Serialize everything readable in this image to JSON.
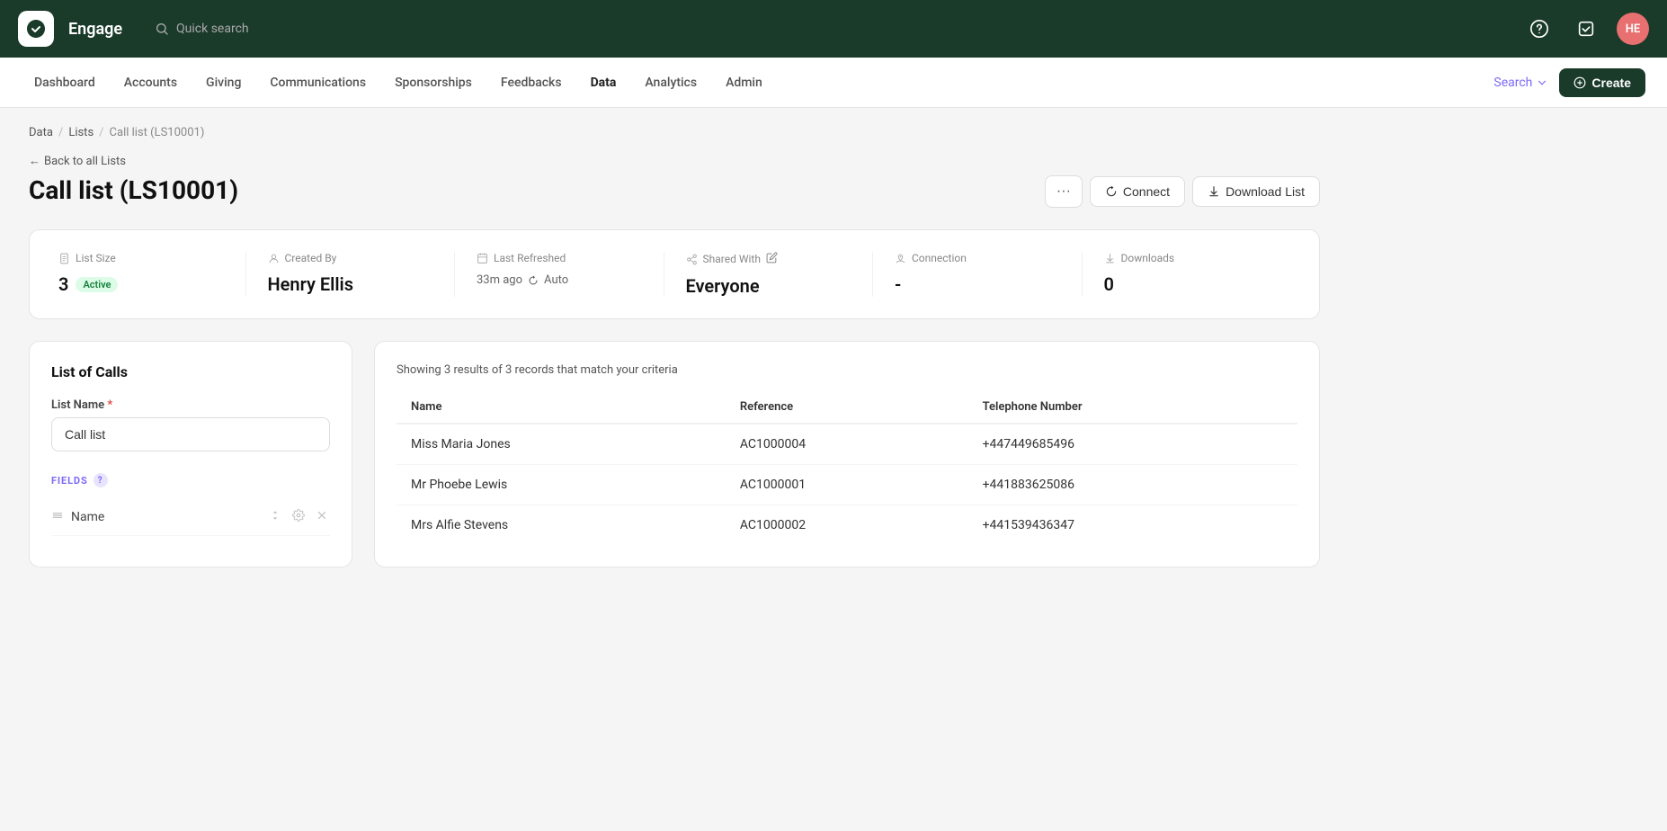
{
  "app": {
    "name": "Engage",
    "logo_alt": "Engage logo"
  },
  "topbar": {
    "quick_search": "Quick search",
    "avatar_initials": "HE",
    "help_icon": "?",
    "task_icon": "✓"
  },
  "nav": {
    "items": [
      {
        "id": "dashboard",
        "label": "Dashboard",
        "active": false
      },
      {
        "id": "accounts",
        "label": "Accounts",
        "active": false
      },
      {
        "id": "giving",
        "label": "Giving",
        "active": false
      },
      {
        "id": "communications",
        "label": "Communications",
        "active": false
      },
      {
        "id": "sponsorships",
        "label": "Sponsorships",
        "active": false
      },
      {
        "id": "feedbacks",
        "label": "Feedbacks",
        "active": false
      },
      {
        "id": "data",
        "label": "Data",
        "active": true
      },
      {
        "id": "analytics",
        "label": "Analytics",
        "active": false
      },
      {
        "id": "admin",
        "label": "Admin",
        "active": false
      }
    ],
    "search_label": "Search",
    "create_label": "Create"
  },
  "breadcrumb": {
    "items": [
      "Data",
      "Lists",
      "Call list (LS10001)"
    ]
  },
  "back_link": "Back to all Lists",
  "page": {
    "title": "Call list (LS10001)",
    "more_btn": "···",
    "connect_btn": "Connect",
    "download_btn": "Download List"
  },
  "stats": {
    "list_size_label": "List Size",
    "list_size_value": "3",
    "list_size_status": "Active",
    "created_by_label": "Created By",
    "created_by_value": "Henry Ellis",
    "last_refreshed_label": "Last Refreshed",
    "last_refreshed_value": "33m ago",
    "last_refreshed_mode": "Auto",
    "shared_with_label": "Shared With",
    "shared_with_value": "Everyone",
    "connection_label": "Connection",
    "connection_value": "-",
    "downloads_label": "Downloads",
    "downloads_value": "0"
  },
  "left_panel": {
    "title": "List of Calls",
    "list_name_label": "List Name",
    "list_name_required": true,
    "list_name_value": "Call list",
    "fields_label": "FIELDS",
    "fields_help": "?",
    "field_rows": [
      {
        "label": "Name"
      }
    ]
  },
  "right_panel": {
    "results_info": "Showing 3 results of 3 records that match your criteria",
    "columns": [
      "Name",
      "Reference",
      "Telephone Number"
    ],
    "rows": [
      {
        "name": "Miss Maria Jones",
        "reference": "AC1000004",
        "telephone": "+447449685496"
      },
      {
        "name": "Mr Phoebe Lewis",
        "reference": "AC1000001",
        "telephone": "+441883625086"
      },
      {
        "name": "Mrs Alfie Stevens",
        "reference": "AC1000002",
        "telephone": "+441539436347"
      }
    ]
  },
  "icons": {
    "search": "🔍",
    "help": "?",
    "task": "☑",
    "back_arrow": "←",
    "connect": "⟳",
    "download": "↓",
    "edit": "✏",
    "refresh": "↻",
    "share": "⇒",
    "connection": "☁",
    "downloads_icon": "↓",
    "file": "📄",
    "person": "👤",
    "clock": "🕐",
    "drag": "≡",
    "settings": "⚙",
    "close": "✕",
    "arrows": "⇅",
    "plus": "+"
  },
  "colors": {
    "topbar_bg": "#1a3a2a",
    "active_nav": "#111",
    "accent": "#7c6af7",
    "active_badge_bg": "#dcfce7",
    "active_badge_text": "#15803d",
    "avatar_bg": "#e87070"
  }
}
